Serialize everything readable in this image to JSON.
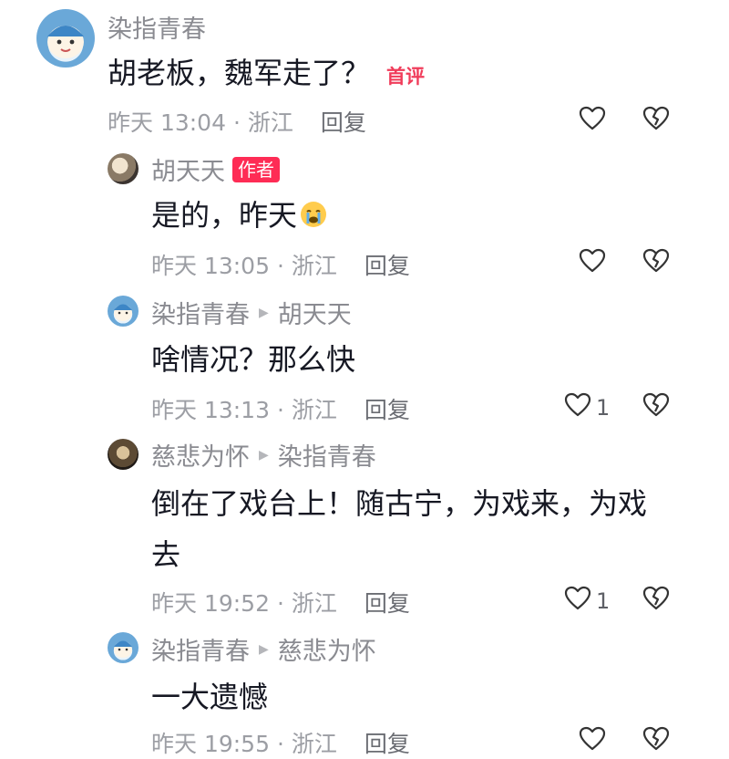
{
  "comments": [
    {
      "name": "染指青春",
      "reply_to": "",
      "badge": "首评",
      "text": "胡老板，魏军走了？",
      "time": "昨天 13:04 · 浙江",
      "reply_label": "回复",
      "likes": ""
    },
    {
      "name": "胡天天",
      "reply_to": "",
      "badge": "作者",
      "text": "是的，昨天",
      "time": "昨天 13:05 · 浙江",
      "reply_label": "回复",
      "likes": ""
    },
    {
      "name": "染指青春",
      "reply_to": "胡天天",
      "text": "啥情况？那么快",
      "time": "昨天 13:13 · 浙江",
      "reply_label": "回复",
      "likes": "1"
    },
    {
      "name": "慈悲为怀",
      "reply_to": "染指青春",
      "text_line1": "倒在了戏台上！随古宁，为戏来，为戏",
      "text_line2": "去",
      "time": "昨天 19:52 · 浙江",
      "reply_label": "回复",
      "likes": "1"
    },
    {
      "name": "染指青春",
      "reply_to": "慈悲为怀",
      "text": "一大遗憾",
      "time": "昨天 19:55 · 浙江",
      "reply_label": "回复",
      "likes": ""
    }
  ],
  "icons": {
    "like": "heart-outline-icon",
    "dislike": "broken-heart-icon",
    "reply_arrow": "play-triangle-icon",
    "emoji": "crying-face-emoji"
  },
  "colors": {
    "author_badge": "#fe2c55",
    "first_badge": "#f03c5a",
    "secondary_text": "#8a8b91"
  }
}
